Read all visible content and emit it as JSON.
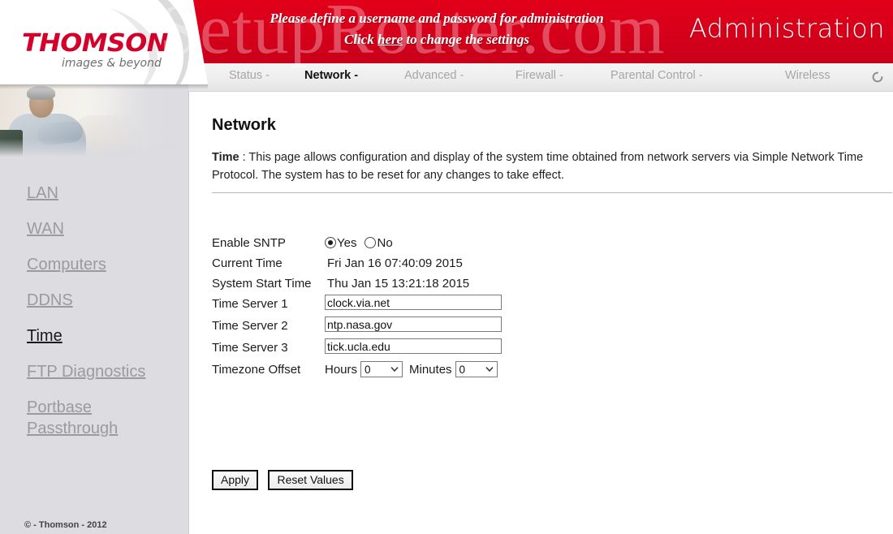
{
  "banner": {
    "message_line1": "Please define a username and password for administration",
    "message_line2_pre": "Click ",
    "message_link": "here",
    "message_line2_post": " to change the settings",
    "admin_title": "Administration",
    "color": "#d8001a"
  },
  "watermark": {
    "text": "SetupRouter.com"
  },
  "logo": {
    "wordmark": "THOMSON",
    "tagline": "images & beyond",
    "brand_color": "#d4002a"
  },
  "nav": {
    "items": [
      {
        "label": "Status -",
        "active": false
      },
      {
        "label": "Network -",
        "active": true
      },
      {
        "label": "Advanced -",
        "active": false
      },
      {
        "label": "Firewall -",
        "active": false
      },
      {
        "label": "Parental Control -",
        "active": false
      },
      {
        "label": "Wireless",
        "active": false
      }
    ],
    "refresh_icon": "refresh-icon"
  },
  "sidebar": {
    "items": [
      {
        "label": "LAN",
        "active": false
      },
      {
        "label": "WAN",
        "active": false
      },
      {
        "label": "Computers",
        "active": false
      },
      {
        "label": "DDNS",
        "active": false
      },
      {
        "label": "Time",
        "active": true
      },
      {
        "label": "FTP Diagnostics",
        "active": false
      },
      {
        "label": "Portbase\nPassthrough",
        "active": false
      }
    ],
    "copyright": "© - Thomson - 2012"
  },
  "main": {
    "title": "Network",
    "desc_label": "Time",
    "desc_sep": " :  ",
    "desc_body": "This page allows configuration and display of the system time obtained from network servers via Simple Network Time Protocol. The system has to be reset for any changes to take effect."
  },
  "form": {
    "enable_sntp": {
      "label": "Enable SNTP",
      "yes_label": "Yes",
      "no_label": "No",
      "selected": "Yes"
    },
    "current_time": {
      "label": "Current Time",
      "value": "Fri Jan 16 07:40:09 2015"
    },
    "system_start_time": {
      "label": "System Start Time",
      "value": "Thu Jan 15 13:21:18 2015"
    },
    "time_server_1": {
      "label": "Time Server 1",
      "value": "clock.via.net"
    },
    "time_server_2": {
      "label": "Time Server 2",
      "value": "ntp.nasa.gov"
    },
    "time_server_3": {
      "label": "Time Server 3",
      "value": "tick.ucla.edu"
    },
    "timezone_offset": {
      "label": "Timezone Offset",
      "hours_label": "Hours",
      "hours_value": "0",
      "minutes_label": "Minutes",
      "minutes_value": "0"
    },
    "apply_button": "Apply",
    "reset_button": "Reset Values"
  }
}
